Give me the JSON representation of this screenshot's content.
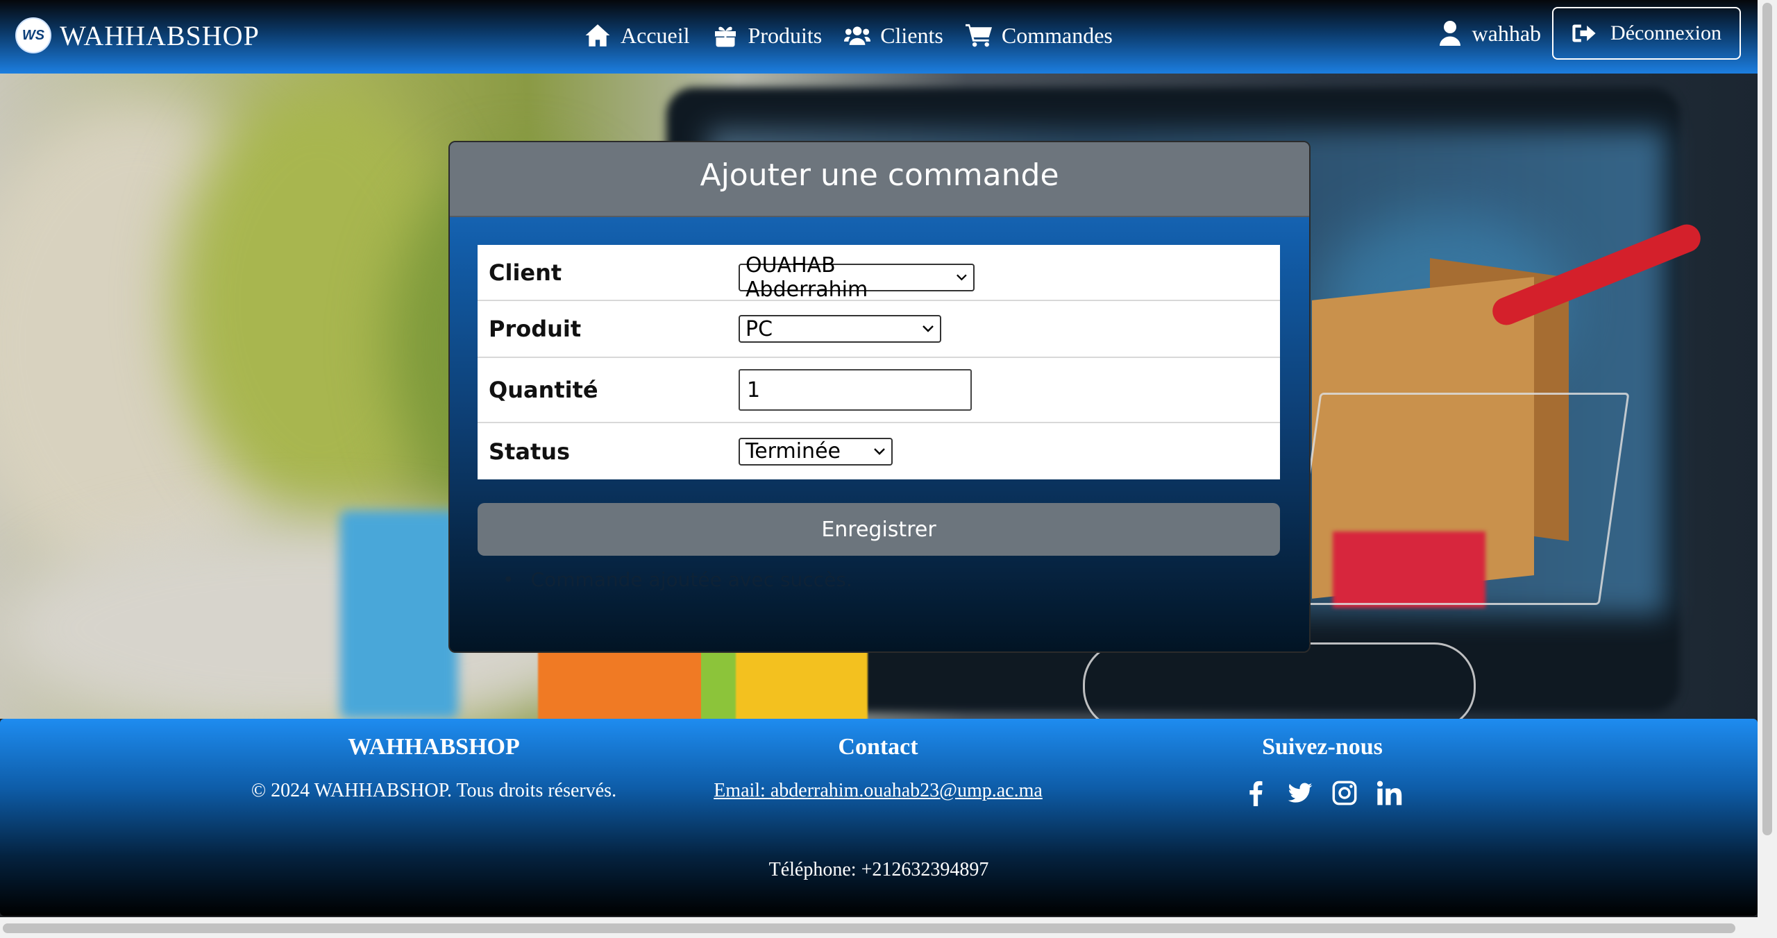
{
  "navbar": {
    "brand_logo": "WS",
    "brand": "WAHHABSHOP",
    "links": {
      "home": "Accueil",
      "products": "Produits",
      "clients": "Clients",
      "orders": "Commandes"
    },
    "user": "wahhab",
    "logout": "Déconnexion"
  },
  "form": {
    "title": "Ajouter une commande",
    "client_label": "Client",
    "client_value": "OUAHAB Abderrahim",
    "product_label": "Produit",
    "product_value": "PC",
    "quantity_label": "Quantité",
    "quantity_value": "1",
    "status_label": "Status",
    "status_value": "Terminée",
    "save_label": "Enregistrer",
    "message": "Commande ajoutée avec succès."
  },
  "footer": {
    "brand_title": "WAHHABSHOP",
    "copyright": "© 2024 WAHHABSHOP. Tous droits réservés.",
    "contact_title": "Contact",
    "email": "Email: abderrahim.ouahab23@ump.ac.ma",
    "follow_title": "Suivez-nous",
    "phone": "Téléphone: +212632394897"
  },
  "icons": [
    "home-icon",
    "gift-icon",
    "users-icon",
    "cart-icon",
    "user-icon",
    "logout-icon",
    "facebook-icon",
    "twitter-icon",
    "instagram-icon",
    "linkedin-icon"
  ],
  "colors": {
    "nav_top": "#05070b",
    "nav_bottom": "#1c7ee0",
    "card_header": "#6d757d",
    "button": "#6c757d",
    "footer_top": "#1e8cf0"
  }
}
